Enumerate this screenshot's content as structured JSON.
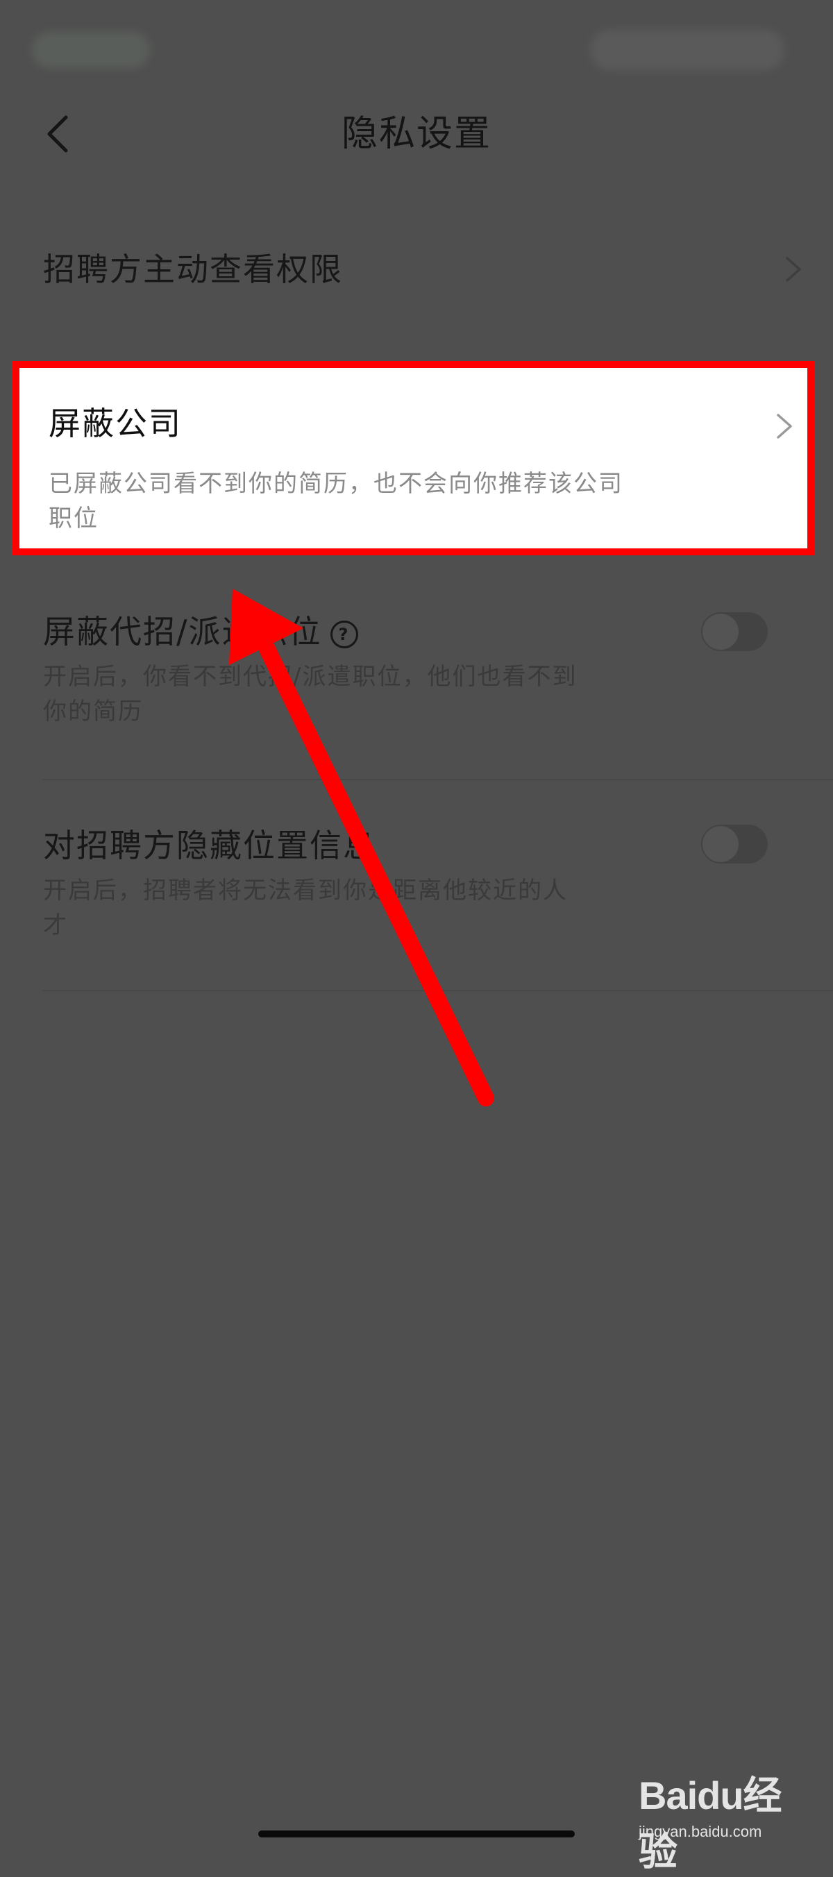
{
  "header": {
    "title": "隐私设置"
  },
  "rows": [
    {
      "title": "招聘方主动查看权限"
    },
    {
      "title": "屏蔽公司",
      "description": "已屏蔽公司看不到你的简历，也不会向你推荐该公司职位"
    },
    {
      "title": "屏蔽代招/派遣职位",
      "description": "开启后，你看不到代招/派遣职位，他们也看不到你的简历",
      "toggle_on": false
    },
    {
      "title": "对招聘方隐藏位置信息",
      "description": "开启后，招聘者将无法看到你是距离他较近的人才",
      "toggle_on": false
    }
  ],
  "icons": {
    "back": "chevron-left-icon",
    "chevron": "chevron-right-icon",
    "help": "question-circle-icon"
  },
  "colors": {
    "overlay_background": "#4f4f4f",
    "highlight_border": "#ff0000",
    "arrow": "#ff0000"
  },
  "watermark": {
    "logo_text": "Baidu经验",
    "url": "jingyan.baidu.com"
  }
}
